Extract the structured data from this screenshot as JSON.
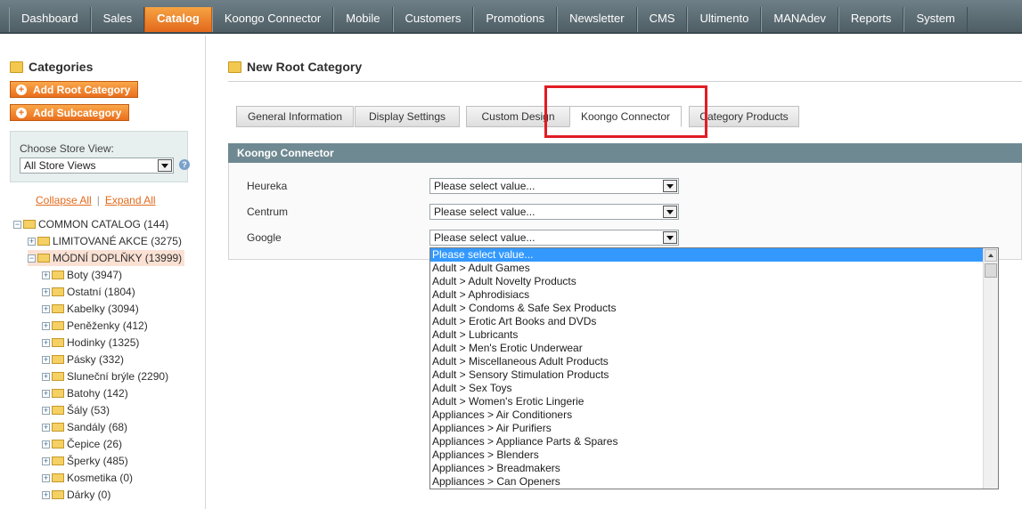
{
  "nav": [
    "Dashboard",
    "Sales",
    "Catalog",
    "Koongo Connector",
    "Mobile",
    "Customers",
    "Promotions",
    "Newsletter",
    "CMS",
    "Ultimento",
    "MANAdev",
    "Reports",
    "System"
  ],
  "sidebar": {
    "title": "Categories",
    "add_root": "Add Root Category",
    "add_sub": "Add Subcategory",
    "store_label": "Choose Store View:",
    "store_value": "All Store Views",
    "help": "?",
    "collapse_all": "Collapse All",
    "separator": "|",
    "expand_all": "Expand All"
  },
  "tree": [
    {
      "label": "COMMON CATALOG (144)",
      "level": 0,
      "expander": "−"
    },
    {
      "label": "LIMITOVANÉ AKCE (3275)",
      "level": 1,
      "expander": "+"
    },
    {
      "label": "MÓDNÍ DOPLŇKY (13999)",
      "level": 1,
      "expander": "−",
      "selected": true
    },
    {
      "label": "Boty (3947)",
      "level": 2,
      "expander": "+"
    },
    {
      "label": "Ostatní (1804)",
      "level": 2,
      "expander": "+"
    },
    {
      "label": "Kabelky (3094)",
      "level": 2,
      "expander": "+"
    },
    {
      "label": "Peněženky (412)",
      "level": 2,
      "expander": "+"
    },
    {
      "label": "Hodinky (1325)",
      "level": 2,
      "expander": "+"
    },
    {
      "label": "Pásky (332)",
      "level": 2,
      "expander": "+"
    },
    {
      "label": "Sluneční brýle (2290)",
      "level": 2,
      "expander": "+"
    },
    {
      "label": "Batohy (142)",
      "level": 2,
      "expander": "+"
    },
    {
      "label": "Šály (53)",
      "level": 2,
      "expander": "+"
    },
    {
      "label": "Sandály (68)",
      "level": 2,
      "expander": "+"
    },
    {
      "label": "Čepice (26)",
      "level": 2,
      "expander": "+"
    },
    {
      "label": "Šperky (485)",
      "level": 2,
      "expander": "+"
    },
    {
      "label": "Kosmetika (0)",
      "level": 2,
      "expander": "+"
    },
    {
      "label": "Dárky (0)",
      "level": 2,
      "expander": "+"
    }
  ],
  "main": {
    "title": "New Root Category",
    "tabs": [
      {
        "label": "General Information",
        "active": false
      },
      {
        "label": "Display Settings",
        "active": false
      },
      {
        "label": "Custom Design",
        "active": false
      },
      {
        "label": "Koongo Connector",
        "active": true
      },
      {
        "label": "Category Products",
        "active": false
      }
    ],
    "section_title": "Koongo Connector",
    "fields": [
      {
        "label": "Heureka",
        "value": "Please select value..."
      },
      {
        "label": "Centrum",
        "value": "Please select value..."
      },
      {
        "label": "Google",
        "value": "Please select value..."
      }
    ],
    "dropdown_options": [
      "Please select value...",
      "Adult > Adult Games",
      "Adult > Adult Novelty Products",
      "Adult > Aphrodisiacs",
      "Adult > Condoms & Safe Sex Products",
      "Adult > Erotic Art Books and DVDs",
      "Adult > Lubricants",
      "Adult > Men's Erotic Underwear",
      "Adult > Miscellaneous Adult Products",
      "Adult > Sensory Stimulation Products",
      "Adult > Sex Toys",
      "Adult > Women's Erotic Lingerie",
      "Appliances > Air Conditioners",
      "Appliances > Air Purifiers",
      "Appliances > Appliance Parts & Spares",
      "Appliances > Blenders",
      "Appliances > Breadmakers",
      "Appliances > Can Openers"
    ]
  },
  "colors": {
    "accent": "#ea6f1d",
    "highlight": "#e11c24",
    "section": "#6f8992",
    "selection": "#3399ff"
  }
}
